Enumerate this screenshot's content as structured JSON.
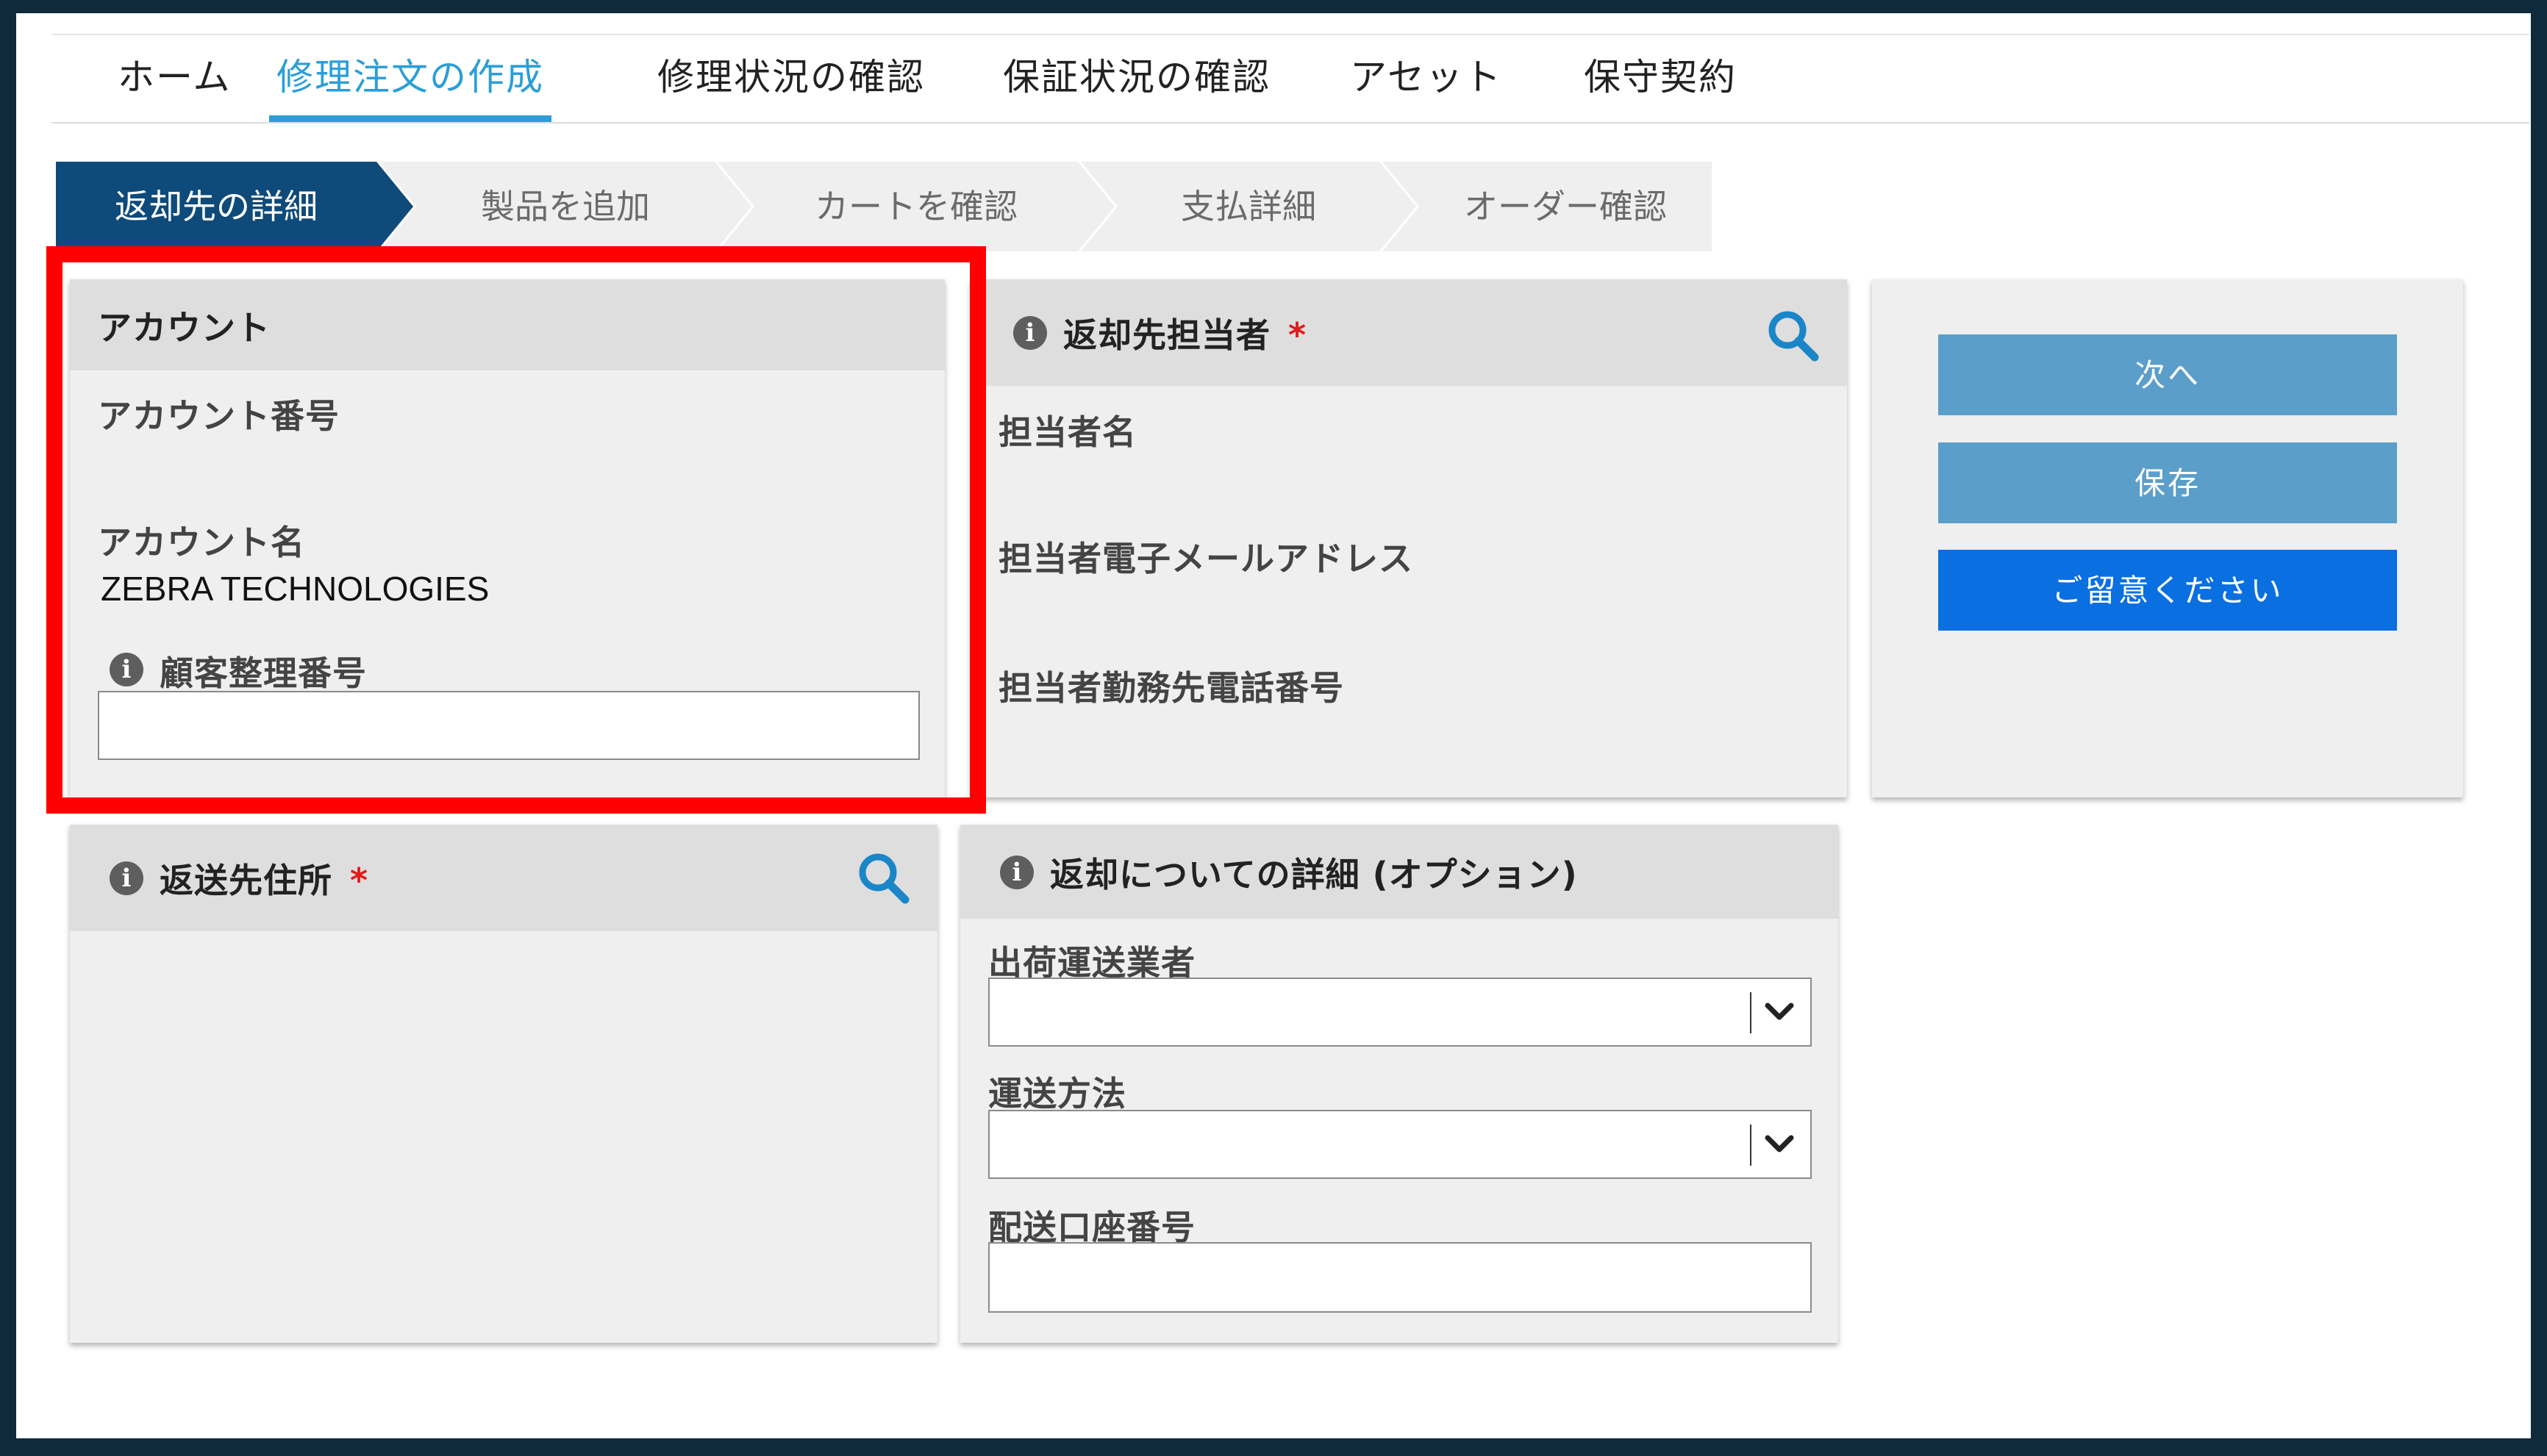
{
  "nav": {
    "tabs": [
      {
        "label": "ホーム"
      },
      {
        "label": "修理注文の作成",
        "active": true
      },
      {
        "label": "修理状況の確認"
      },
      {
        "label": "保証状況の確認"
      },
      {
        "label": "アセット"
      },
      {
        "label": "保守契約"
      }
    ]
  },
  "steps": [
    {
      "label": "返却先の詳細",
      "active": true
    },
    {
      "label": "製品を追加"
    },
    {
      "label": "カートを確認"
    },
    {
      "label": "支払詳細"
    },
    {
      "label": "オーダー確認"
    }
  ],
  "account": {
    "title": "アカウント",
    "number_label": "アカウント番号",
    "name_label": "アカウント名",
    "name_value": "ZEBRA TECHNOLOGIES",
    "customer_ref_label": "顧客整理番号",
    "customer_ref_value": ""
  },
  "contact": {
    "title": "返却先担当者",
    "required_mark": "*",
    "name_label": "担当者名",
    "email_label": "担当者電子メールアドレス",
    "phone_label": "担当者勤務先電話番号"
  },
  "actions": {
    "next_label": "次へ",
    "save_label": "保存",
    "notice_label": "ご留意ください"
  },
  "address": {
    "title": "返送先住所",
    "required_mark": "*"
  },
  "return_details": {
    "title": "返却についての詳細 (オプション)",
    "carrier_label": "出荷運送業者",
    "carrier_value": "",
    "method_label": "運送方法",
    "method_value": "",
    "shipping_account_label": "配送口座番号",
    "shipping_account_value": ""
  },
  "colors": {
    "frame": "#0e2a3b",
    "nav_active": "#2b9ed8",
    "step_active": "#0e4a7a",
    "step_inactive": "#efefef",
    "button_secondary": "#5b9ec9",
    "button_primary": "#0a6fe0",
    "search_icon": "#1a86c8",
    "required": "#e21a1a",
    "highlight": "#ff0000"
  }
}
